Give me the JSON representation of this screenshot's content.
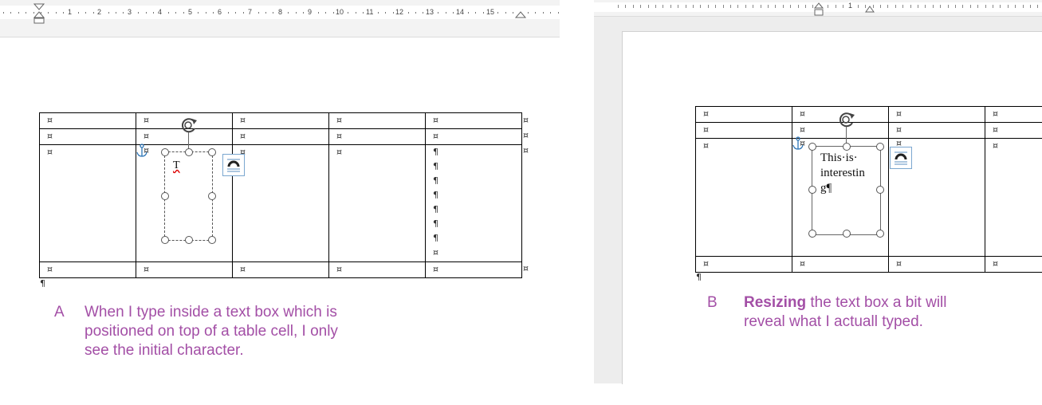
{
  "left_panel": {
    "ruler_numbers": [
      "1",
      "2",
      "3",
      "4",
      "5",
      "6",
      "7",
      "8",
      "9",
      "10",
      "11",
      "12",
      "13",
      "14",
      "15"
    ],
    "table_mark": "¤",
    "pilcrow": "¶",
    "textbox_char": "T",
    "caption_letter": "A",
    "caption_lines": [
      "When I type inside a text box which is",
      "positioned on top of a table cell, I only",
      "see the initial character."
    ]
  },
  "right_panel": {
    "ruler_numbers": [
      "1"
    ],
    "table_mark": "¤",
    "pilcrow": "¶",
    "textbox_lines": [
      "This·is·",
      "interestin",
      "g¶"
    ],
    "caption_letter": "B",
    "caption_bold": "Resizing",
    "caption_rest_line1": " the text box a bit will",
    "caption_line2": "reveal what I actuall typed."
  },
  "colors": {
    "caption": "#a34fa6",
    "ruler_bg": "#f3f3f3",
    "page_gray": "#ededed",
    "layout_icon_border": "#7ba7d0"
  },
  "icons": [
    "anchor-icon",
    "rotate-handle-icon",
    "layout-options-icon"
  ]
}
